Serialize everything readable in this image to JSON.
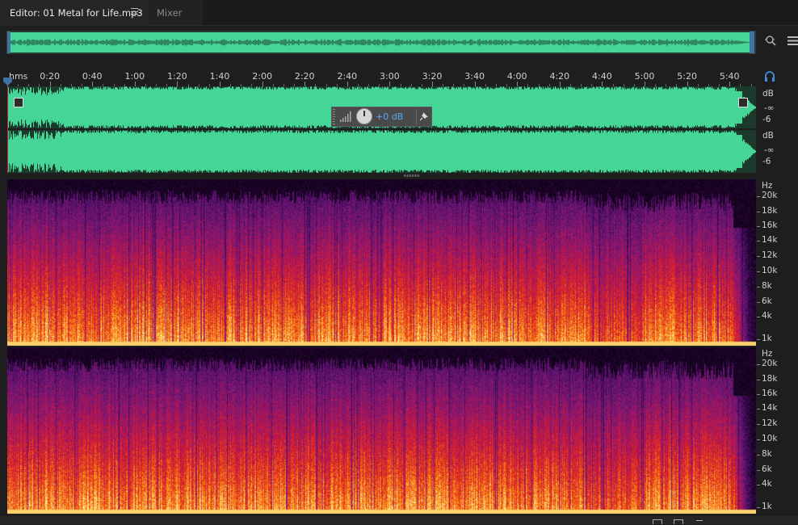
{
  "tabs": {
    "editor_label": "Editor: 01 Metal for Life.mp3",
    "mixer_label": "Mixer"
  },
  "ruler": {
    "unit": "hms",
    "labels": [
      "0:20",
      "0:40",
      "1:00",
      "1:20",
      "1:40",
      "2:00",
      "2:20",
      "2:40",
      "3:00",
      "3:20",
      "3:40",
      "4:00",
      "4:20",
      "4:40",
      "5:00",
      "5:20",
      "5:40"
    ]
  },
  "hud": {
    "volume_value": "+0 dB"
  },
  "amplitude_scale": {
    "channel1": [
      "dB",
      "-∞",
      "-6"
    ],
    "channel2": [
      "dB",
      "-∞",
      "-6"
    ]
  },
  "frequency_scale": {
    "unit": "Hz",
    "labels": [
      "20k",
      "18k",
      "16k",
      "14k",
      "12k",
      "10k",
      "8k",
      "6k",
      "4k",
      "1k"
    ]
  },
  "colors": {
    "waveform": "#45d597",
    "playhead": "#3f74a0",
    "hud_value": "#5aa8ef"
  },
  "icons": [
    "menu-icon",
    "zoom-icon",
    "list-icon",
    "headphone-icon",
    "volume-meter-icon",
    "pin-icon"
  ]
}
